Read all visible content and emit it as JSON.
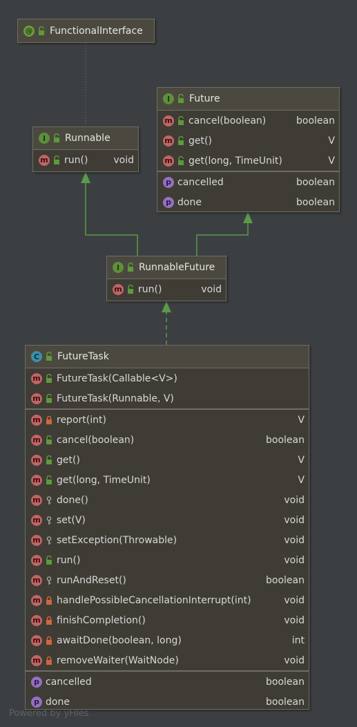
{
  "nodes": {
    "functional_interface": {
      "kind": "@",
      "title": "FunctionalInterface"
    },
    "runnable": {
      "kind": "I",
      "title": "Runnable",
      "members": [
        {
          "kind": "m",
          "vis": "public",
          "name": "run()",
          "type": "void"
        }
      ]
    },
    "future": {
      "kind": "I",
      "title": "Future",
      "members": [
        {
          "kind": "m",
          "vis": "public",
          "name": "cancel(boolean)",
          "type": "boolean"
        },
        {
          "kind": "m",
          "vis": "public",
          "name": "get()",
          "type": "V"
        },
        {
          "kind": "m",
          "vis": "public",
          "name": "get(long, TimeUnit)",
          "type": "V"
        }
      ],
      "properties": [
        {
          "kind": "p",
          "name": "cancelled",
          "type": "boolean"
        },
        {
          "kind": "p",
          "name": "done",
          "type": "boolean"
        }
      ]
    },
    "runnable_future": {
      "kind": "I",
      "title": "RunnableFuture",
      "members": [
        {
          "kind": "m",
          "vis": "public",
          "name": "run()",
          "type": "void"
        }
      ]
    },
    "future_task": {
      "kind": "C",
      "title": "FutureTask",
      "constructors": [
        {
          "kind": "m",
          "vis": "public",
          "name": "FutureTask(Callable<V>)",
          "type": ""
        },
        {
          "kind": "m",
          "vis": "public",
          "name": "FutureTask(Runnable, V)",
          "type": ""
        }
      ],
      "members": [
        {
          "kind": "m",
          "vis": "private",
          "name": "report(int)",
          "type": "V"
        },
        {
          "kind": "m",
          "vis": "public",
          "name": "cancel(boolean)",
          "type": "boolean"
        },
        {
          "kind": "m",
          "vis": "public",
          "name": "get()",
          "type": "V"
        },
        {
          "kind": "m",
          "vis": "public",
          "name": "get(long, TimeUnit)",
          "type": "V"
        },
        {
          "kind": "m",
          "vis": "protected",
          "name": "done()",
          "type": "void"
        },
        {
          "kind": "m",
          "vis": "protected",
          "name": "set(V)",
          "type": "void"
        },
        {
          "kind": "m",
          "vis": "protected",
          "name": "setException(Throwable)",
          "type": "void"
        },
        {
          "kind": "m",
          "vis": "public",
          "name": "run()",
          "type": "void"
        },
        {
          "kind": "m",
          "vis": "protected",
          "name": "runAndReset()",
          "type": "boolean"
        },
        {
          "kind": "m",
          "vis": "private",
          "name": "handlePossibleCancellationInterrupt(int)",
          "type": "void"
        },
        {
          "kind": "m",
          "vis": "private",
          "name": "finishCompletion()",
          "type": "void"
        },
        {
          "kind": "m",
          "vis": "private",
          "name": "awaitDone(boolean, long)",
          "type": "int"
        },
        {
          "kind": "m",
          "vis": "private",
          "name": "removeWaiter(WaitNode)",
          "type": "void"
        }
      ],
      "properties": [
        {
          "kind": "p",
          "name": "cancelled",
          "type": "boolean"
        },
        {
          "kind": "p",
          "name": "done",
          "type": "boolean"
        }
      ]
    }
  },
  "colors": {
    "background": "#3c3f41",
    "edge": "#5a9a4a",
    "annotation_edge": "#8a8a8a"
  },
  "footer": "Powered by yFiles"
}
